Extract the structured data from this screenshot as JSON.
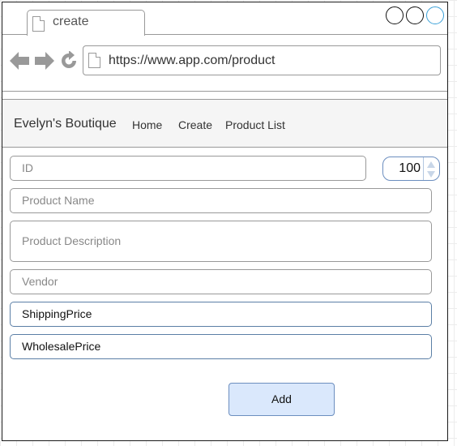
{
  "browser": {
    "tab": {
      "title": "create"
    },
    "address_bar": {
      "url": "https://www.app.com/product"
    }
  },
  "app": {
    "brand": "Evelyn's Boutique",
    "nav": [
      {
        "label": "Home"
      },
      {
        "label": "Create"
      },
      {
        "label": "Product List"
      }
    ]
  },
  "form": {
    "id": {
      "placeholder": "ID"
    },
    "id_stepper": {
      "value": "100"
    },
    "product_name": {
      "placeholder": "Product Name"
    },
    "product_description": {
      "placeholder": "Product Description"
    },
    "vendor": {
      "placeholder": "Vendor"
    },
    "shipping_price": {
      "value": "ShippingPrice"
    },
    "wholesale_price": {
      "value": "WholesalePrice"
    },
    "add_label": "Add"
  },
  "colors": {
    "accent": "#dae8fc",
    "accent_border": "#6c8ebf",
    "navbar_bg": "#f5f5f5",
    "close_button_ring": "#3aa0d8"
  },
  "icons": [
    "page-icon",
    "back-arrow-icon",
    "forward-arrow-icon",
    "reload-icon",
    "stepper-up-icon",
    "stepper-down-icon"
  ]
}
